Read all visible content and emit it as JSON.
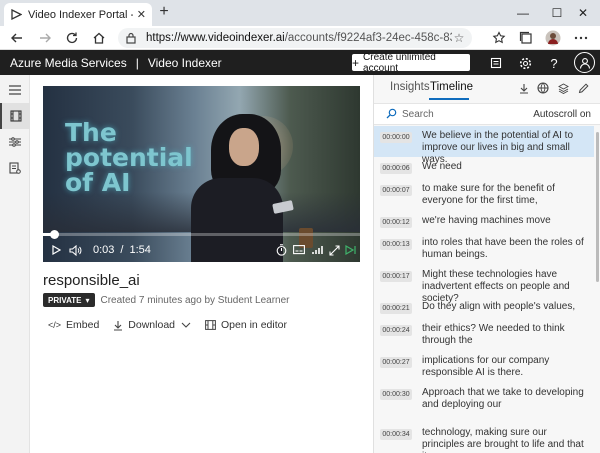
{
  "browser": {
    "tab_title": "Video Indexer Portal - Cognitive",
    "close_glyph": "✕",
    "newtab_glyph": "+",
    "url_host": "https://www.videoindexer.ai",
    "url_path": "/accounts/f9224af3-24ec-458c-83d9-ae4...",
    "window_controls": {
      "minimize": "—",
      "maximize": "☐",
      "close": "✕"
    }
  },
  "header": {
    "brand": "Azure Media Services",
    "separator": "|",
    "product": "Video Indexer",
    "create_button": "Create unlimited account",
    "create_plus": "+"
  },
  "video": {
    "title_overlay_line1": "The",
    "title_overlay_line2": "potential",
    "title_overlay_line3": "of AI",
    "current_time": "0:03",
    "time_separator": "/",
    "duration": "1:54",
    "progress_fraction": 0.026
  },
  "details": {
    "name": "responsible_ai",
    "privacy": "PRIVATE",
    "privacy_caret": "▾",
    "meta": "Created 7 minutes ago by Student Learner",
    "actions": {
      "embed": "Embed",
      "embed_icon": "</>",
      "download": "Download",
      "open_editor": "Open in editor"
    }
  },
  "panel": {
    "tabs": [
      "Insights",
      "Timeline"
    ],
    "active_tab": "Timeline",
    "search_placeholder": "Search",
    "autoscroll": "Autoscroll on",
    "transcript": [
      {
        "time": "00:00:00",
        "text": "We believe in the potential of AI to improve our lives in big and small ways.",
        "selected": true
      },
      {
        "time": "00:00:06",
        "text": "We need"
      },
      {
        "time": "00:00:07",
        "text": "to make sure for the benefit of everyone for the first time,"
      },
      {
        "time": "00:00:12",
        "text": "we're having machines move"
      },
      {
        "time": "00:00:13",
        "text": "into roles that have been the roles of human beings."
      },
      {
        "time": "00:00:17",
        "text": "Might these technologies have inadvertent effects on people and society?"
      },
      {
        "time": "00:00:21",
        "text": "Do they align with people's values,"
      },
      {
        "time": "00:00:24",
        "text": "their ethics? We needed to think through the"
      },
      {
        "time": "00:00:27",
        "text": "implications for our company responsible AI is there."
      },
      {
        "time": "00:00:30",
        "text": "Approach that we take to developing and deploying our"
      },
      {
        "time": "00:00:34",
        "text": "technology, making sure our principles are brought to life and that it empowers"
      }
    ]
  },
  "colors": {
    "accent": "#0f6cbd",
    "header_bg": "#1f1f1f",
    "selected_row": "#d4e6f6"
  }
}
